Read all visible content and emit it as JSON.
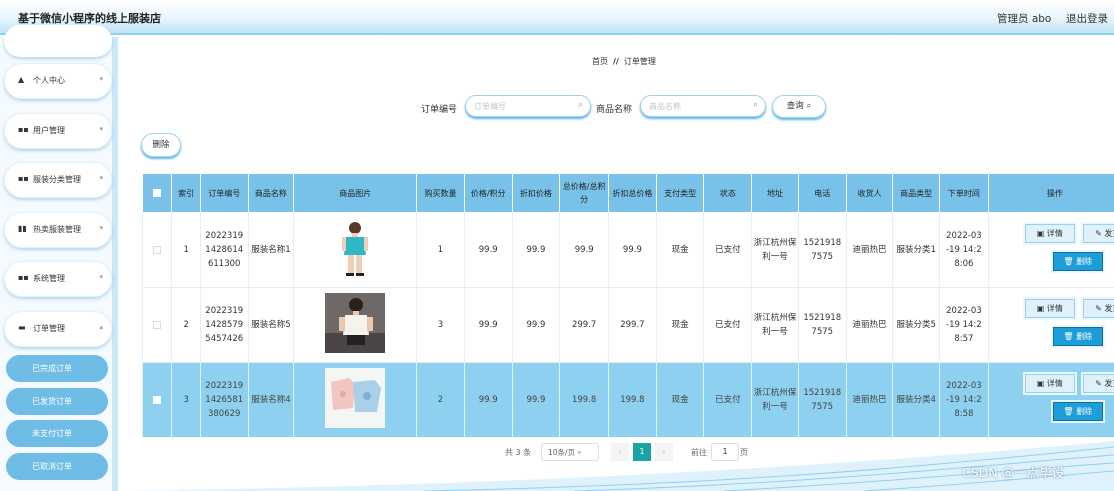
{
  "header": {
    "title": "基于微信小程序的线上服装店",
    "user": "管理员 abo",
    "logout": "退出登录"
  },
  "sidebar": {
    "items": [
      {
        "icon": "person-icon",
        "glyph": "▲",
        "label": "个人中心"
      },
      {
        "icon": "grid-icon",
        "glyph": "■■",
        "label": "用户管理"
      },
      {
        "icon": "grid-icon",
        "glyph": "■■",
        "label": "服装分类管理"
      },
      {
        "icon": "chart-icon",
        "glyph": "▮▮",
        "label": "热卖服装管理"
      },
      {
        "icon": "grid-icon",
        "glyph": "■■",
        "label": "系统管理"
      },
      {
        "icon": "cart-icon",
        "glyph": "▬",
        "label": "订单管理"
      }
    ],
    "subitems": [
      "已完成订单",
      "已发货订单",
      "未支付订单",
      "已取消订单"
    ]
  },
  "breadcrumb": {
    "home": "首页",
    "separator": "//",
    "current": "订单管理"
  },
  "search": {
    "order_label": "订单编号",
    "order_placeholder": "订单编号",
    "product_label": "商品名称",
    "product_placeholder": "商品名称",
    "query_button": "查询"
  },
  "toolbar": {
    "delete_label": "删除"
  },
  "table": {
    "headers": [
      "索引",
      "订单编号",
      "商品名称",
      "商品图片",
      "购买数量",
      "价格/积分",
      "折扣价格",
      "总价格/总积分",
      "折扣总价格",
      "支付类型",
      "状态",
      "地址",
      "电话",
      "收货人",
      "商品类型",
      "下单时间",
      "操作"
    ],
    "rows": [
      {
        "index": "1",
        "order_no": "2022319 1428614 611300",
        "product": "服装名称1",
        "qty": "1",
        "price": "99.9",
        "discount": "99.9",
        "total": "99.9",
        "discount_total": "99.9",
        "pay_type": "现金",
        "status": "已支付",
        "address": "浙江杭州保利一号",
        "phone": "1521918 7575",
        "receiver": "迪丽热巴",
        "category": "服装分类1",
        "time": "2022-03 -19 14:2 8:06"
      },
      {
        "index": "2",
        "order_no": "2022319 1428579 5457426",
        "product": "服装名称5",
        "qty": "3",
        "price": "99.9",
        "discount": "99.9",
        "total": "299.7",
        "discount_total": "299.7",
        "pay_type": "现金",
        "status": "已支付",
        "address": "浙江杭州保利一号",
        "phone": "1521918 7575",
        "receiver": "迪丽热巴",
        "category": "服装分类5",
        "time": "2022-03 -19 14:2 8:57"
      },
      {
        "index": "3",
        "order_no": "2022319 1426581 380629",
        "product": "服装名称4",
        "qty": "2",
        "price": "99.9",
        "discount": "99.9",
        "total": "199.8",
        "discount_total": "199.8",
        "pay_type": "现金",
        "status": "已支付",
        "address": "浙江杭州保利一号",
        "phone": "1521918 7575",
        "receiver": "迪丽热巴",
        "category": "服装分类4",
        "time": "2022-03 -19 14:2 8:58"
      }
    ],
    "actions": {
      "detail": "详情",
      "ship": "发货",
      "delete": "删除"
    }
  },
  "pagination": {
    "total": "共 3 条",
    "page_size": "10条/页",
    "current_page": "1",
    "goto_label": "前往",
    "goto_value": "1",
    "page_suffix": "页"
  },
  "watermark": "CSDN @一点毕设",
  "colors": {
    "header_accent": "#8fd0f1",
    "table_header": "#78c2ea",
    "action_button": "#1e9ed8",
    "selected_row": "#8ed0ef"
  }
}
